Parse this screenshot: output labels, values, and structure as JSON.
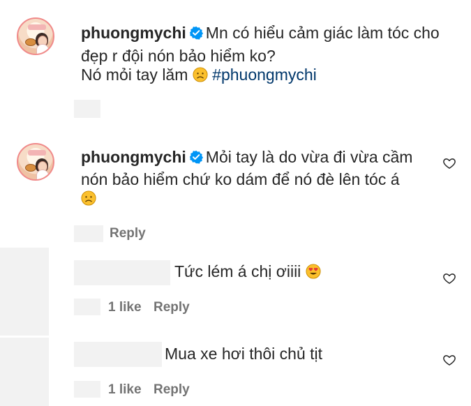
{
  "caption": {
    "username": "phuongmychi",
    "text_line1": "Mn có hiểu cảm giác làm tóc cho",
    "text_line2": "đẹp r đội nón bảo hiểm ko?",
    "text_line3": "Nó mỏi tay lăm",
    "hashtag": "#phuongmychi"
  },
  "comments": [
    {
      "username": "phuongmychi",
      "text_line1": "Mỏi tay là do vừa đi vừa cầm",
      "text_line2": "nón bảo hiểm chứ ko dám để nó đè lên tóc á",
      "reply_label": "Reply"
    },
    {
      "text": "Tức lém á chị ơiiii",
      "likes_label": "1 like",
      "reply_label": "Reply"
    },
    {
      "text": "Mua xe hơi thôi chủ tịt",
      "likes_label": "1 like",
      "reply_label": "Reply"
    }
  ],
  "colors": {
    "text": "#262626",
    "meta": "#737373",
    "hashtag": "#00376b",
    "verified": "#0095f6"
  },
  "icons": [
    "verified-badge-icon",
    "sad-face-emoji",
    "heart-eyes-emoji",
    "heart-icon"
  ]
}
